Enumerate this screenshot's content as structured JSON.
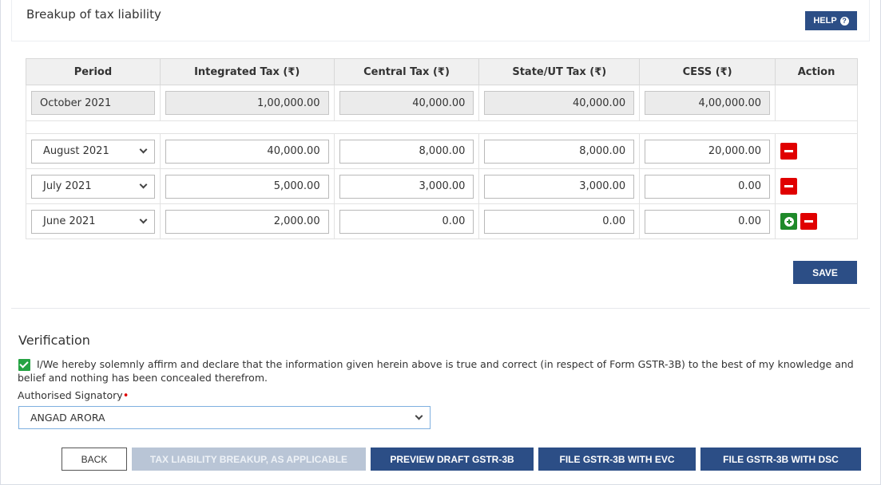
{
  "section_title": "Breakup of tax liability",
  "help_label": "HELP",
  "table": {
    "headers": [
      "Period",
      "Integrated Tax (₹)",
      "Central Tax (₹)",
      "State/UT Tax (₹)",
      "CESS (₹)",
      "Action"
    ],
    "current": {
      "period": "October 2021",
      "igst": "1,00,000.00",
      "cgst": "40,000.00",
      "sgst": "40,000.00",
      "cess": "4,00,000.00"
    },
    "rows": [
      {
        "period": "August 2021",
        "igst": "40,000.00",
        "cgst": "8,000.00",
        "sgst": "8,000.00",
        "cess": "20,000.00"
      },
      {
        "period": "July 2021",
        "igst": "5,000.00",
        "cgst": "3,000.00",
        "sgst": "3,000.00",
        "cess": "0.00"
      },
      {
        "period": "June 2021",
        "igst": "2,000.00",
        "cgst": "0.00",
        "sgst": "0.00",
        "cess": "0.00"
      }
    ]
  },
  "save_label": "SAVE",
  "verification": {
    "title": "Verification",
    "declaration": "I/We hereby solemnly affirm and declare that the information given herein above is true and correct (in respect of Form GSTR-3B) to the best of my knowledge and belief and nothing has been concealed therefrom.",
    "checked": true,
    "signatory_label": "Authorised Signatory",
    "required_mark": "•",
    "signatory_value": "ANGAD ARORA"
  },
  "buttons": {
    "back": "BACK",
    "breakup": "TAX LIABILITY BREAKUP, AS APPLICABLE",
    "preview": "PREVIEW DRAFT GSTR-3B",
    "evc": "FILE GSTR-3B WITH EVC",
    "dsc": "FILE GSTR-3B WITH DSC"
  },
  "colors": {
    "primary": "#2c4e86",
    "disabled": "#b9c5d6",
    "remove": "#e00000",
    "add": "#1f8a2a",
    "check": "#25a343"
  },
  "icons": {
    "help": "question-circle-icon",
    "remove": "minus-icon",
    "add": "plus-circle-icon",
    "dropdown": "chevron-down-icon",
    "checkbox": "checkmark-icon"
  }
}
